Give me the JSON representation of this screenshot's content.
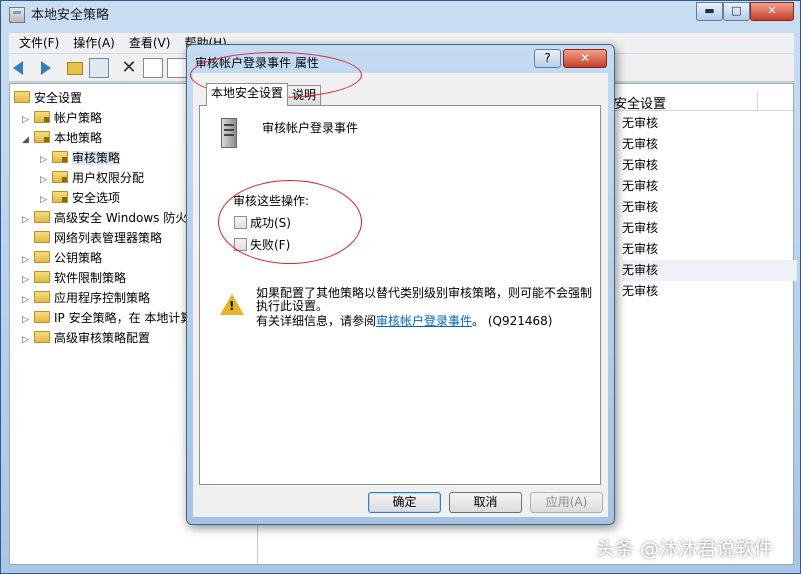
{
  "window": {
    "title": "本地安全策略",
    "min_glyph": "▬",
    "max_glyph": "□",
    "close_glyph": "✕"
  },
  "menu": [
    "文件(F)",
    "操作(A)",
    "查看(V)",
    "帮助(H)"
  ],
  "tree": {
    "items": [
      {
        "label": "安全设置",
        "level": 0,
        "expanded": true
      },
      {
        "label": "帐户策略",
        "level": 1,
        "expanded": false
      },
      {
        "label": "本地策略",
        "level": 1,
        "expanded": true
      },
      {
        "label": "审核策略",
        "level": 2,
        "expanded": false,
        "selected": true
      },
      {
        "label": "用户权限分配",
        "level": 2,
        "expanded": false
      },
      {
        "label": "安全选项",
        "level": 2,
        "expanded": false
      },
      {
        "label": "高级安全 Windows 防火墙",
        "level": 1,
        "expanded": false
      },
      {
        "label": "网络列表管理器策略",
        "level": 1,
        "expanded": false
      },
      {
        "label": "公钥策略",
        "level": 1,
        "expanded": false
      },
      {
        "label": "软件限制策略",
        "level": 1,
        "expanded": false
      },
      {
        "label": "应用程序控制策略",
        "level": 1,
        "expanded": false
      },
      {
        "label": "IP 安全策略，在 本地计算机",
        "level": 1,
        "expanded": false
      },
      {
        "label": "高级审核策略配置",
        "level": 1,
        "expanded": false
      }
    ]
  },
  "right_pane": {
    "column_header": "安全设置",
    "rows": [
      "无审核",
      "无审核",
      "无审核",
      "无审核",
      "无审核",
      "无审核",
      "无审核",
      "无审核",
      "无审核"
    ]
  },
  "dialog": {
    "title": "审核帐户登录事件 属性",
    "help_glyph": "?",
    "close_glyph": "✕",
    "tabs": [
      "本地安全设置",
      "说明"
    ],
    "policy_name": "审核帐户登录事件",
    "ops_label": "审核这些操作:",
    "checkboxes": [
      {
        "label": "成功(S)",
        "checked": false
      },
      {
        "label": "失败(F)",
        "checked": false
      }
    ],
    "warning_text": "如果配置了其他策略以替代类别级别审核策略，则可能不会强制执行此设置。",
    "more_info_prefix": "有关详细信息，请参阅",
    "more_info_link": "审核帐户登录事件",
    "more_info_suffix": "。 (Q921468)",
    "buttons": {
      "ok": "确定",
      "cancel": "取消",
      "apply": "应用(A)"
    }
  },
  "watermark": "头条 @沐沐君说软件",
  "colors": {
    "annotation": "#d6252b",
    "link": "#0066cc"
  }
}
